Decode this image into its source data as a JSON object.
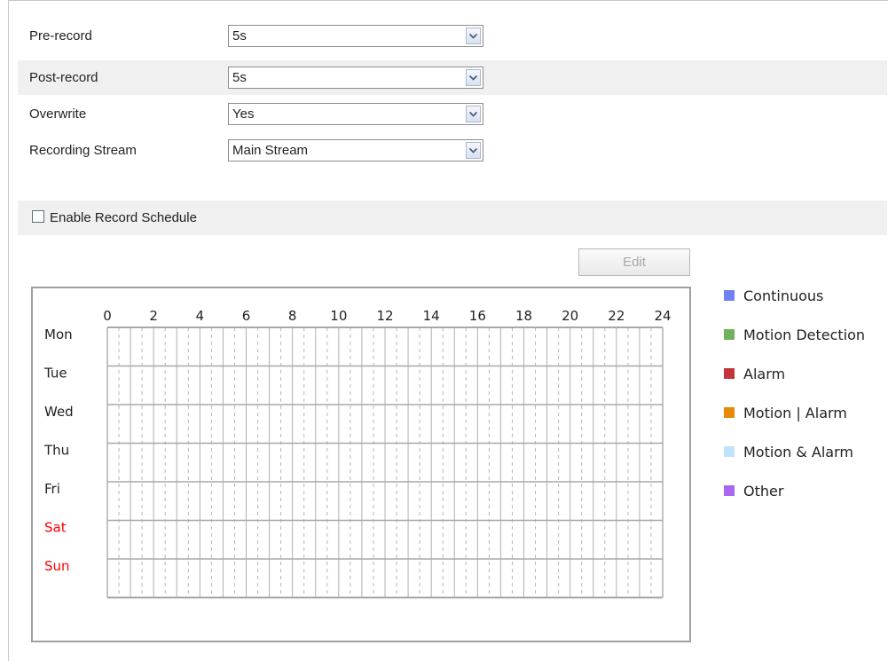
{
  "settings": [
    {
      "label": "Pre-record",
      "value": "5s"
    },
    {
      "label": "Post-record",
      "value": "5s"
    },
    {
      "label": "Overwrite",
      "value": "Yes"
    },
    {
      "label": "Recording Stream",
      "value": "Main Stream"
    }
  ],
  "schedule": {
    "enable_label": "Enable Record Schedule",
    "enabled": false,
    "edit_label": "Edit"
  },
  "grid": {
    "hours": [
      "0",
      "2",
      "4",
      "6",
      "8",
      "10",
      "12",
      "14",
      "16",
      "18",
      "20",
      "22",
      "24"
    ],
    "days": [
      {
        "label": "Mon",
        "color": "#222222"
      },
      {
        "label": "Tue",
        "color": "#222222"
      },
      {
        "label": "Wed",
        "color": "#222222"
      },
      {
        "label": "Thu",
        "color": "#222222"
      },
      {
        "label": "Fri",
        "color": "#222222"
      },
      {
        "label": "Sat",
        "color": "#ff0000"
      },
      {
        "label": "Sun",
        "color": "#ff0000"
      }
    ]
  },
  "legend": [
    {
      "label": "Continuous",
      "color": "#6f7ff4"
    },
    {
      "label": "Motion Detection",
      "color": "#71b25d"
    },
    {
      "label": "Alarm",
      "color": "#c1353d"
    },
    {
      "label": "Motion | Alarm",
      "color": "#e88a05"
    },
    {
      "label": "Motion & Alarm",
      "color": "#bfe3fb"
    },
    {
      "label": "Other",
      "color": "#aa66ee"
    }
  ]
}
